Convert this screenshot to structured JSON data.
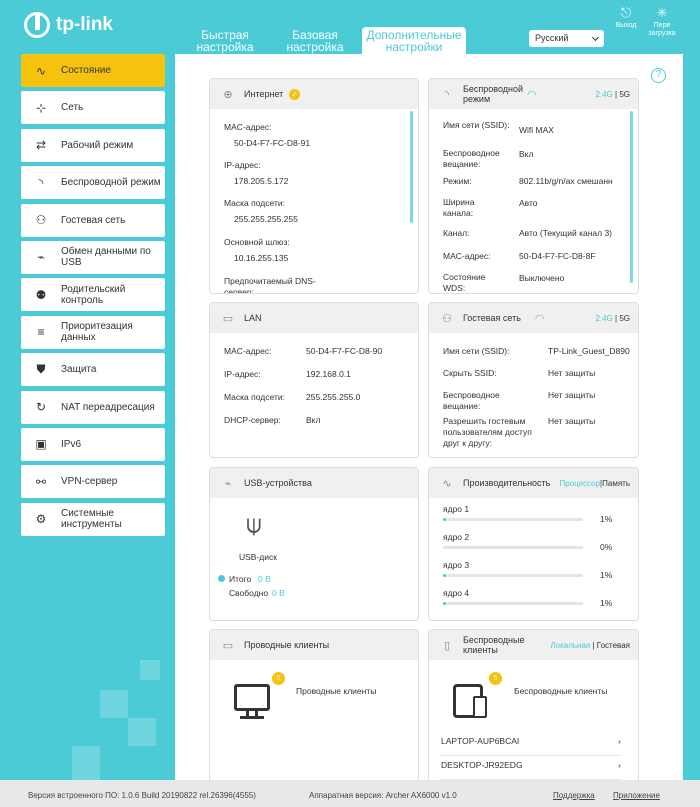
{
  "brand": {
    "name": "tp-link"
  },
  "tabs": [
    {
      "label": "Быстрая настройка"
    },
    {
      "label": "Базовая настройка"
    },
    {
      "label": "Дополнительные настройки"
    }
  ],
  "language": "Русский",
  "header_buttons": {
    "logout": "Выход",
    "reboot": "Пере загрузка"
  },
  "sidebar": {
    "items": [
      {
        "label": "Состояние",
        "icon": "pulse-icon"
      },
      {
        "label": "Сеть",
        "icon": "network-icon"
      },
      {
        "label": "Рабочий режим",
        "icon": "mode-icon"
      },
      {
        "label": "Беспроводной режим",
        "icon": "wireless-icon"
      },
      {
        "label": "Гостевая сеть",
        "icon": "guest-icon"
      },
      {
        "label": "Обмен данными по USB",
        "icon": "usb-icon"
      },
      {
        "label": "Родительский контроль",
        "icon": "parental-icon"
      },
      {
        "label": "Приоритезация данных",
        "icon": "qos-icon"
      },
      {
        "label": "Защита",
        "icon": "shield-icon"
      },
      {
        "label": "NAT переадресация",
        "icon": "nat-icon"
      },
      {
        "label": "IPv6",
        "icon": "ipv6-icon"
      },
      {
        "label": "VPN-сервер",
        "icon": "vpn-icon"
      },
      {
        "label": "Системные инструменты",
        "icon": "tools-icon"
      }
    ]
  },
  "internet": {
    "title": "Интернет",
    "mac_label": "MAC-адрес:",
    "mac": "50-D4-F7-FC-D8-91",
    "ip_label": "IP-адрес:",
    "ip": "178.205.5.172",
    "mask_label": "Маска подсети:",
    "mask": "255.255.255.255",
    "gw_label": "Основной шлюз:",
    "gw": "10.16.255.135",
    "dns_label": "Предпочитаемый DNS-сервер:"
  },
  "wireless": {
    "title": "Беспроводной режим",
    "band_24": "2.4G",
    "band_sep": "|",
    "band_5": "5G",
    "rows": [
      {
        "label": "Имя сети (SSID):",
        "value": "Wifi MAX"
      },
      {
        "label": "Беспроводное вещание:",
        "value": "Вкл"
      },
      {
        "label": "Режим:",
        "value": "802.11b/g/n/ax смешанн"
      },
      {
        "label": "Ширина канала:",
        "value": "Авто"
      },
      {
        "label": "Канал:",
        "value": "Авто (Текущий канал 3)"
      },
      {
        "label": "MAC-адрес:",
        "value": "50-D4-F7-FC-D8-8F"
      },
      {
        "label": "Состояние WDS:",
        "value": "Выключено"
      }
    ]
  },
  "lan": {
    "title": "LAN",
    "rows": [
      {
        "label": "MAC-адрес:",
        "value": "50-D4-F7-FC-D8-90"
      },
      {
        "label": "IP-адрес:",
        "value": "192.168.0.1"
      },
      {
        "label": "Маска подсети:",
        "value": "255.255.255.0"
      },
      {
        "label": "DHCP-сервер:",
        "value": "Вкл"
      }
    ]
  },
  "guest": {
    "title": "Гостевая сеть",
    "band_24": "2.4G",
    "band_sep": "|",
    "band_5": "5G",
    "rows": [
      {
        "label": "Имя сети (SSID):",
        "value": "TP-Link_Guest_D890"
      },
      {
        "label": "Скрыть SSID:",
        "value": "Нет защиты"
      },
      {
        "label": "Беспроводное вещание:",
        "value": "Нет защиты"
      },
      {
        "label": "Разрешить гостевым пользователям доступ друг к другу:",
        "value": "Нет защиты"
      }
    ]
  },
  "usb": {
    "title": "USB-устройства",
    "device": "USB-диск",
    "total_label": "Итого",
    "total_value": "0 В",
    "free_label": "Свободно",
    "free_value": "0 В"
  },
  "performance": {
    "title": "Производительность",
    "tab_cpu": "Процессор",
    "sep": "|",
    "tab_mem": "Память",
    "cores": [
      {
        "label": "ядро 1",
        "value": "1%",
        "level": 0.01
      },
      {
        "label": "ядро 2",
        "value": "0%",
        "level": 0.0
      },
      {
        "label": "ядро 3",
        "value": "1%",
        "level": 0.01
      },
      {
        "label": "ядро 4",
        "value": "1%",
        "level": 0.01
      }
    ]
  },
  "wired_clients": {
    "title": "Проводные клиенты",
    "count": "0",
    "label": "Проводные клиенты"
  },
  "wireless_clients": {
    "title": "Беспроводные клиенты",
    "tab_local": "Локальная",
    "sep": "|",
    "tab_guest": "Гостевая",
    "count": "5",
    "label": "Беспроводные клиенты",
    "clients": [
      {
        "name": "LAPTOP-AUP6BCAI"
      },
      {
        "name": "DESKTOP-JR92EDG"
      }
    ]
  },
  "footer": {
    "firmware": "Версия встроенного ПО: 1.0.6 Build 20190822 rel.26396(4555)",
    "hardware": "Аппаратная версия: Archer AX6000 v1.0",
    "support": "Поддержка",
    "app": "Приложение"
  },
  "colors": {
    "accent": "#4acbd6",
    "active": "#f5c20d",
    "check": "#f5c20d"
  }
}
